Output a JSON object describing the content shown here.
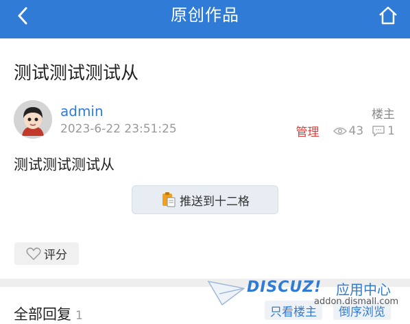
{
  "header": {
    "title": "原创作品",
    "back_icon": "chevron-left-icon",
    "home_icon": "home-icon"
  },
  "post": {
    "title": "测试测试测试从",
    "author": "admin",
    "date": "2023-6-22 23:51:25",
    "floor": "楼主",
    "manage": "管理",
    "views": "43",
    "comments": "1",
    "content": "测试测试测试从",
    "push_label": "推送到十二格",
    "rate_label": "评分"
  },
  "replies": {
    "label": "全部回复",
    "count": "1",
    "only_author": "只看楼主",
    "reverse": "倒序浏览"
  },
  "watermark": {
    "brand": "DISCUZ!",
    "app_center": "应用中心",
    "url": "addon.dismall.com"
  },
  "colors": {
    "accent": "#2f7bd5",
    "manage": "#e53935"
  }
}
